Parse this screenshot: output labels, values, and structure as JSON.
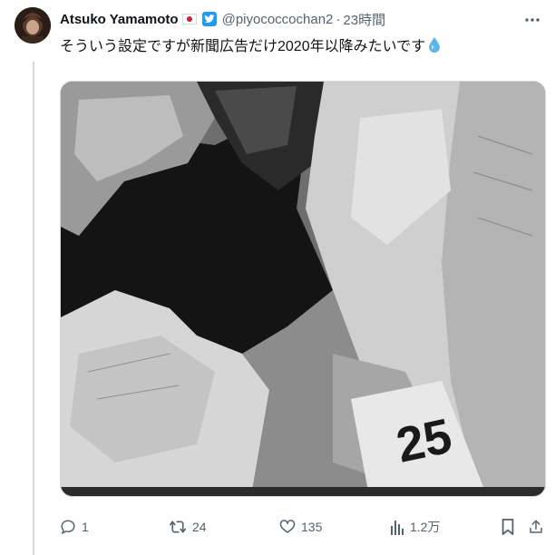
{
  "tweet": {
    "display_name": "Atsuko Yamamoto",
    "handle": "@piyococcochan2",
    "separator": "·",
    "timestamp": "23時間",
    "text": "そういう設定ですが新聞広告だけ2020年以降みたいです",
    "flag_emoji": "japan-flag-icon",
    "drop_emoji": "droplet-icon"
  },
  "media": {
    "description_colors": {
      "dark": "#1a1a1a",
      "mid": "#7a7a7a",
      "light": "#d8d8d8"
    },
    "visible_headline_text": "25"
  },
  "actions": {
    "reply": {
      "count": "1",
      "icon": "reply-icon"
    },
    "retweet": {
      "count": "24",
      "icon": "retweet-icon"
    },
    "like": {
      "count": "135",
      "icon": "heart-icon"
    },
    "views": {
      "count": "1.2万",
      "icon": "views-icon"
    },
    "bookmark": {
      "icon": "bookmark-icon"
    },
    "share": {
      "icon": "share-icon"
    }
  },
  "colors": {
    "accent": "#1d9bf0",
    "secondary_text": "#536471",
    "border": "#cfd9de"
  }
}
